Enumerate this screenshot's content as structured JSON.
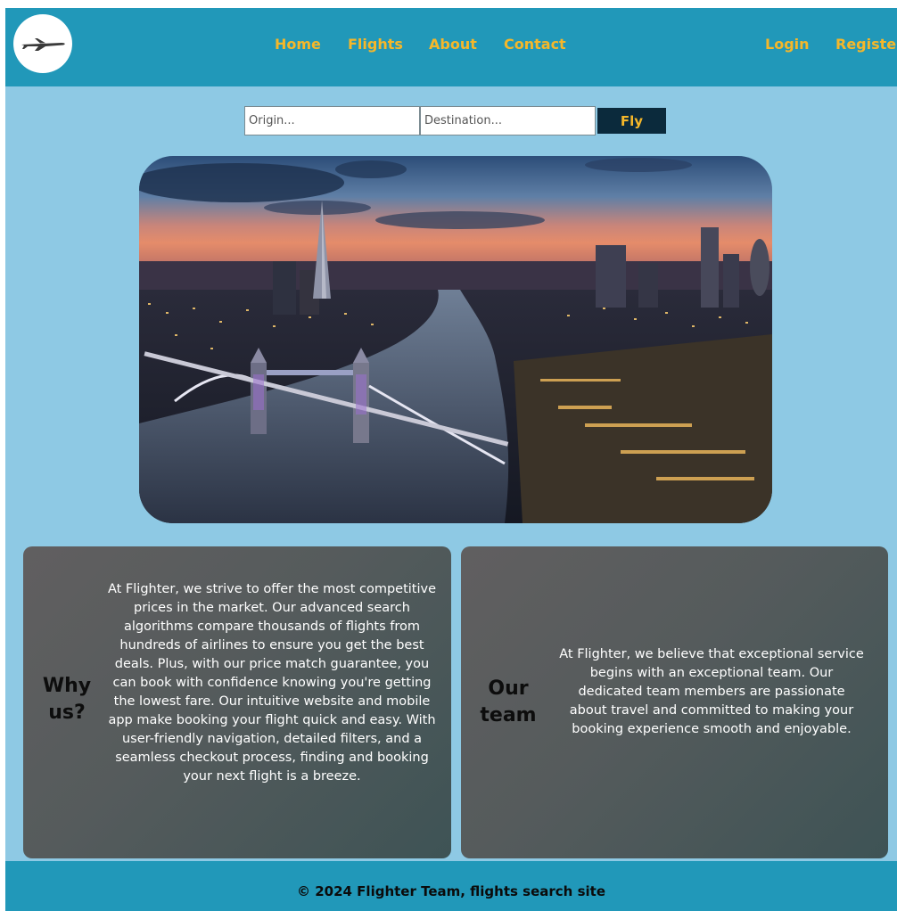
{
  "header": {
    "logo_alt": "airplane-logo",
    "nav": {
      "home": "Home",
      "flights": "Flights",
      "about": "About",
      "contact": "Contact"
    },
    "auth": {
      "login": "Login",
      "register": "Register"
    }
  },
  "search": {
    "origin_placeholder": "Origin...",
    "destination_placeholder": "Destination...",
    "fly_label": "Fly"
  },
  "hero": {
    "image": "city-skyline-bridge-river"
  },
  "cards": {
    "why_us": {
      "title": "Why us?",
      "text": "At Flighter, we strive to offer the most competitive prices in the market. Our advanced search algorithms compare thousands of flights from hundreds of airlines to ensure you get the best deals. Plus, with our price match guarantee, you can book with confidence knowing you're getting the lowest fare. Our intuitive website and mobile app make booking your flight quick and easy. With user-friendly navigation, detailed filters, and a seamless checkout process, finding and booking your next flight is a breeze."
    },
    "our_team": {
      "title": "Our team",
      "text": "At Flighter, we believe that exceptional service begins with an exceptional team. Our dedicated team members are passionate about travel and committed to making your booking experience smooth and enjoyable."
    }
  },
  "footer": {
    "text": "© 2024 Flighter Team, flights search site"
  },
  "colors": {
    "header_bg": "#2198b9",
    "page_bg": "#8ec9e4",
    "accent": "#f5b72a",
    "fly_button_bg": "#0b2a3c"
  }
}
